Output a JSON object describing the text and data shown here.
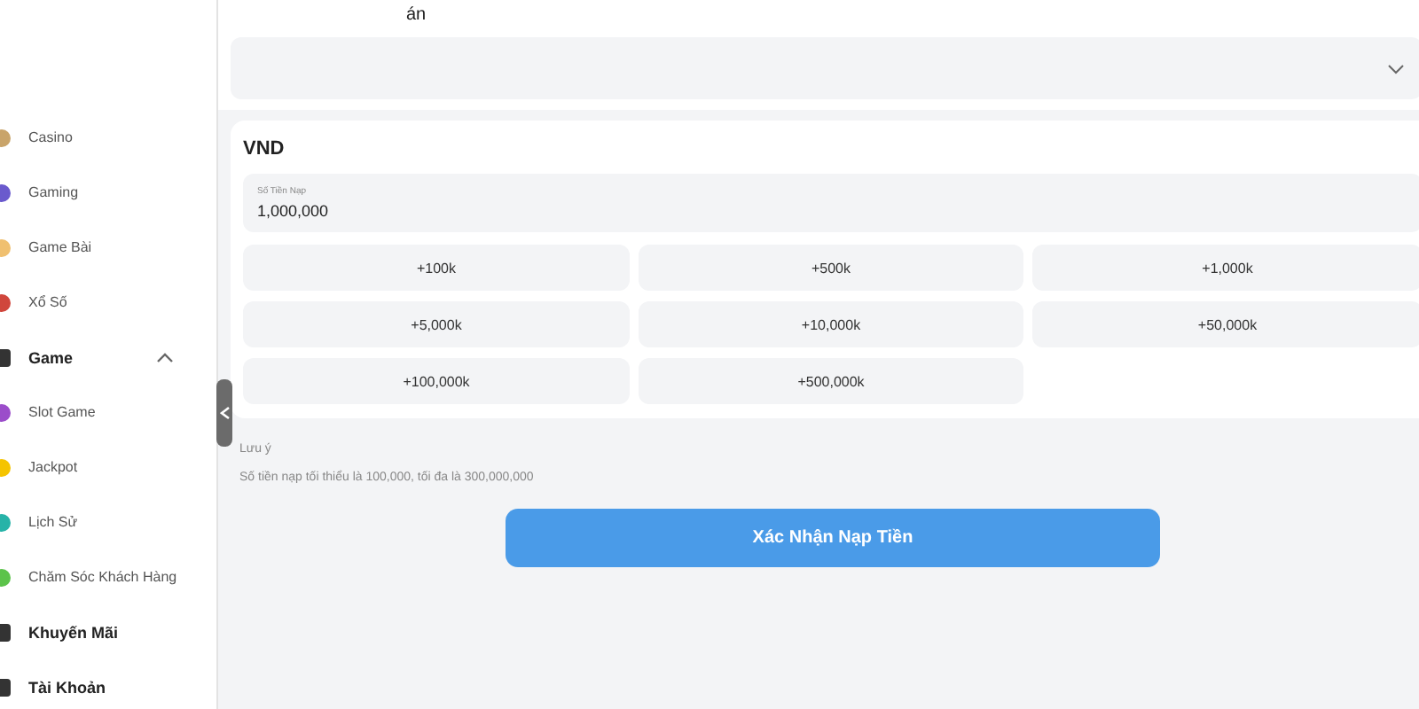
{
  "header": {
    "title": "án"
  },
  "sidebar": {
    "items": [
      {
        "kind": "item",
        "label": "Casino",
        "color": "#c9a46a"
      },
      {
        "kind": "item",
        "label": "Gaming",
        "color": "#6a5acd"
      },
      {
        "kind": "item",
        "label": "Game Bài",
        "color": "#f0c070"
      },
      {
        "kind": "item",
        "label": "Xổ Số",
        "color": "#d0463c"
      },
      {
        "kind": "section",
        "label": "Game",
        "expanded": true,
        "color": "#333333"
      },
      {
        "kind": "item",
        "label": "Slot Game",
        "color": "#9b4dca"
      },
      {
        "kind": "item",
        "label": "Jackpot",
        "color": "#f5c400"
      },
      {
        "kind": "item",
        "label": "Lịch Sử",
        "color": "#27b3a8"
      },
      {
        "kind": "item",
        "label": "Chăm Sóc Khách Hàng",
        "color": "#5cc34a"
      },
      {
        "kind": "section",
        "label": "Khuyến Mãi",
        "color": "#333333"
      },
      {
        "kind": "section",
        "label": "Tài Khoản",
        "color": "#333333"
      }
    ]
  },
  "card": {
    "currency": "VND",
    "amount": {
      "label": "Số Tiền Nạp",
      "value": "1,000,000"
    },
    "presets": [
      "+100k",
      "+500k",
      "+1,000k",
      "+5,000k",
      "+10,000k",
      "+50,000k",
      "+100,000k",
      "+500,000k"
    ]
  },
  "note": {
    "title": "Lưu ý",
    "text": "Số tiền nạp tối thiểu là 100,000, tối đa là 300,000,000"
  },
  "confirm_button": "Xác Nhận Nạp Tiền"
}
